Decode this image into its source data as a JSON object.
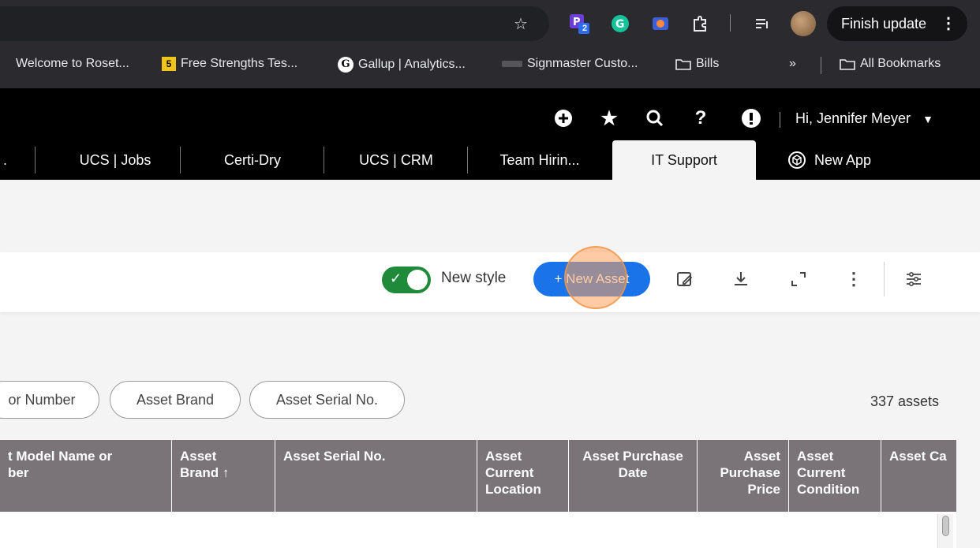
{
  "browser": {
    "finish_update": "Finish update",
    "bookmarks": [
      {
        "label": "Welcome to Roset...",
        "icon": "page-icon"
      },
      {
        "label": "Free Strengths Tes...",
        "icon": "five-badge-icon",
        "badge": "5"
      },
      {
        "label": "Gallup | Analytics...",
        "icon": "gallup-g-icon",
        "badge": "G"
      },
      {
        "label": "Signmaster Custo...",
        "icon": "signmaster-icon"
      },
      {
        "label": "Bills",
        "icon": "folder-icon"
      }
    ],
    "overflow": "»",
    "all_bookmarks": "All Bookmarks",
    "extension_badge": "2"
  },
  "header": {
    "user_greeting": "Hi, Jennifer Meyer",
    "tabs": [
      {
        "label": "UCS | Jobs"
      },
      {
        "label": "Certi-Dry"
      },
      {
        "label": "UCS | CRM"
      },
      {
        "label": "Team Hirin..."
      },
      {
        "label": "IT Support"
      },
      {
        "label": "New App"
      }
    ]
  },
  "toolbar": {
    "new_style_label": "New style",
    "new_asset_label": "+ New Asset"
  },
  "filters": {
    "chips": [
      "or Number",
      "Asset Brand",
      "Asset Serial No."
    ],
    "asset_count": "337 assets"
  },
  "table": {
    "columns": [
      {
        "lines": [
          "t Model Name or",
          "ber"
        ]
      },
      {
        "lines": [
          "Asset",
          "Brand ↑"
        ]
      },
      {
        "lines": [
          "Asset Serial No."
        ]
      },
      {
        "lines": [
          "Asset",
          "Current",
          "Location"
        ]
      },
      {
        "lines": [
          "Asset Purchase",
          "Date"
        ]
      },
      {
        "lines": [
          "Asset",
          "Purchase",
          "Price"
        ]
      },
      {
        "lines": [
          "Asset",
          "Current",
          "Condition"
        ]
      },
      {
        "lines": [
          "Asset Ca"
        ]
      }
    ]
  },
  "colors": {
    "accent": "#1a73e8",
    "toggle_on": "#1e8a3a",
    "table_header": "#7a7478",
    "app_header": "#000000"
  }
}
